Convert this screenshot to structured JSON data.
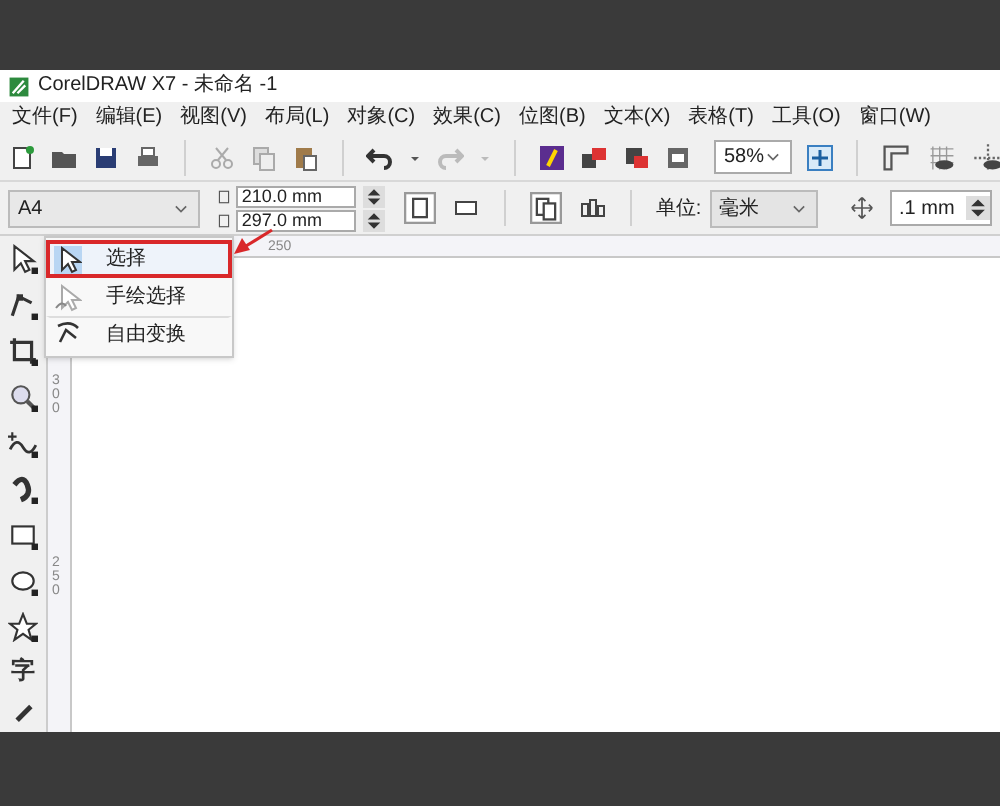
{
  "window": {
    "title": "CorelDRAW X7 - 未命名 -1"
  },
  "menu": [
    "文件(F)",
    "编辑(E)",
    "视图(V)",
    "布局(L)",
    "对象(C)",
    "效果(C)",
    "位图(B)",
    "文本(X)",
    "表格(T)",
    "工具(O)",
    "窗口(W)"
  ],
  "zoom": {
    "value": "58%"
  },
  "property_bar": {
    "page_size": "A4",
    "width": "210.0 mm",
    "height": "297.0 mm",
    "units_label": "单位:",
    "units": "毫米",
    "nudge": ".1 mm"
  },
  "horizontal_ruler": {
    "labels": [
      "250"
    ]
  },
  "vertical_ruler": {
    "labels": [
      "300",
      "250"
    ]
  },
  "toolbox": {
    "text_tool": "字"
  },
  "flyout": {
    "items": [
      {
        "label": "选择",
        "selected": true
      },
      {
        "label": "手绘选择",
        "selected": false
      },
      {
        "label": "自由变换",
        "selected": false
      }
    ]
  }
}
